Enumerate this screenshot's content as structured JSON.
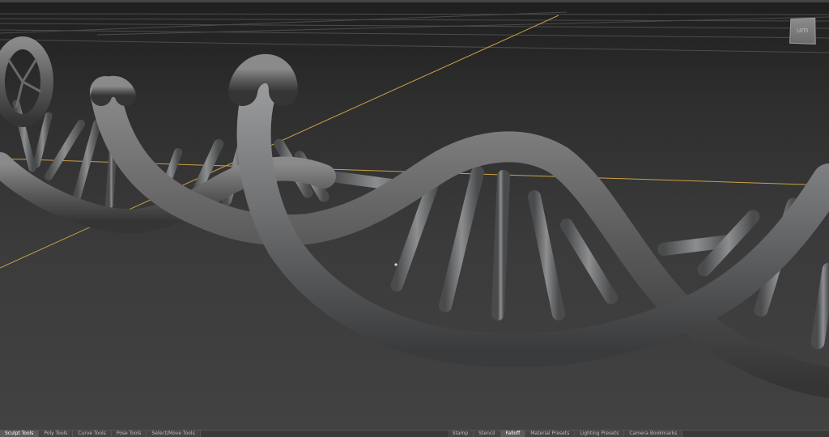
{
  "viewport": {
    "viewcube_label": "um"
  },
  "tabs_left": [
    {
      "label": "Sculpt Tools"
    },
    {
      "label": "Poly Tools"
    },
    {
      "label": "Curve Tools"
    },
    {
      "label": "Pose Tools"
    },
    {
      "label": "Select/Move Tools"
    }
  ],
  "tabs_right": [
    {
      "label": "Stamp"
    },
    {
      "label": "Stencil"
    },
    {
      "label": "Falloff"
    },
    {
      "label": "Material Presets"
    },
    {
      "label": "Lighting Presets"
    },
    {
      "label": "Camera Bookmarks"
    }
  ],
  "colors": {
    "grid_axis": "#c9a045",
    "grid_line": "#5a5a5a",
    "mesh": "#6a6c6e"
  }
}
